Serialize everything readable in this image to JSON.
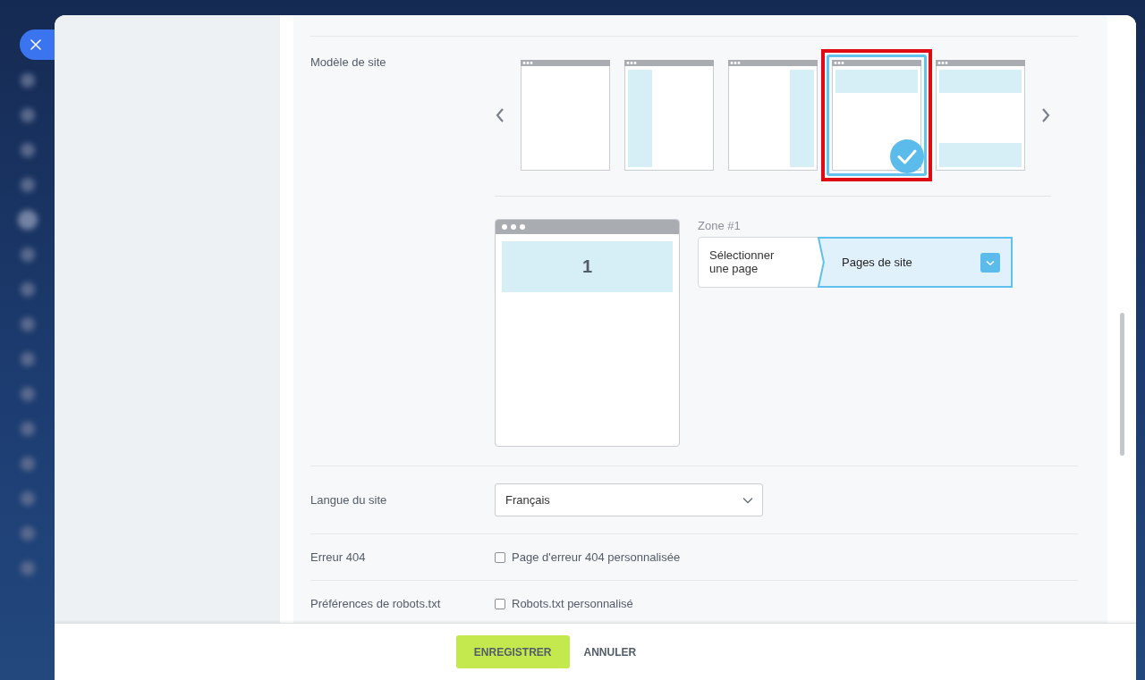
{
  "sidebar": {
    "icons": [
      {
        "selected": false
      },
      {
        "selected": false
      },
      {
        "selected": false
      },
      {
        "selected": false
      },
      {
        "selected": true
      },
      {
        "selected": false
      },
      {
        "selected": false
      },
      {
        "selected": false
      },
      {
        "selected": false
      },
      {
        "selected": false
      },
      {
        "selected": false
      },
      {
        "selected": false
      },
      {
        "selected": false
      },
      {
        "selected": false
      },
      {
        "selected": false
      }
    ]
  },
  "template": {
    "label": "Modèle de site",
    "layouts": [
      {
        "kind": "plain",
        "selected": false
      },
      {
        "kind": "left-column",
        "selected": false
      },
      {
        "kind": "right-column",
        "selected": false
      },
      {
        "kind": "header",
        "selected": true
      },
      {
        "kind": "header-footer",
        "selected": false
      }
    ]
  },
  "preview": {
    "zones": [
      {
        "label": "1"
      }
    ]
  },
  "zone": {
    "label": "Zone #1",
    "mode": "Sélectionner une page",
    "value": "Pages de site"
  },
  "language": {
    "label": "Langue du site",
    "value": "Français"
  },
  "error_page": {
    "label": "Erreur 404",
    "option": "Page d'erreur 404 personnalisée",
    "checked": false
  },
  "robots": {
    "label": "Préférences de robots.txt",
    "option": "Robots.txt personnalisé",
    "checked": false
  },
  "buttons": [
    {
      "label": "ENREGISTRER",
      "kind": "primary"
    },
    {
      "label": "ANNULER",
      "kind": "link"
    }
  ]
}
